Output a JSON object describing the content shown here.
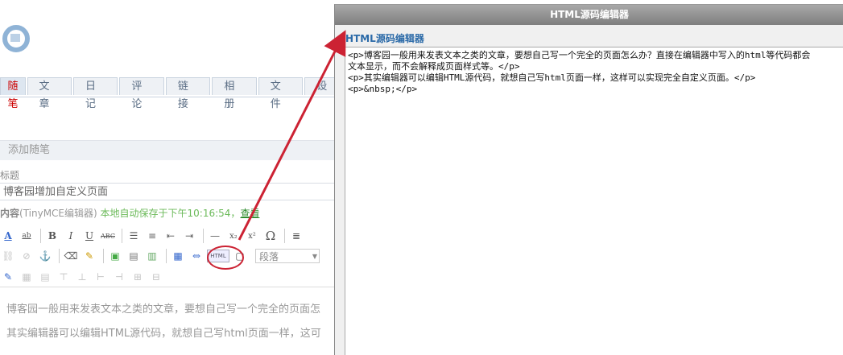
{
  "tabs": [
    {
      "label": "随笔",
      "active": true
    },
    {
      "label": "文章"
    },
    {
      "label": "日记"
    },
    {
      "label": "评论"
    },
    {
      "label": "链接"
    },
    {
      "label": "相册"
    },
    {
      "label": "文件"
    },
    {
      "label": "设置"
    }
  ],
  "add_bar_label": "添加随笔",
  "title_label": "标题",
  "title_value": "博客园增加自定义页面",
  "content_label": {
    "main": "内容",
    "editor": "(TinyMCE编辑器)",
    "autosave": "本地自动保存于下午10:16:54，",
    "link": "查看"
  },
  "toolbar": {
    "html_button": "HTML",
    "format_select": "段落"
  },
  "editor_paragraphs": [
    "博客园一般用来发表文本之类的文章，要想自己写一个完全的页面怎",
    "其实编辑器可以编辑HTML源代码，就想自己写html页面一样，这可"
  ],
  "dialog": {
    "title": "HTML源码编辑器",
    "heading": "HTML源码编辑器",
    "code_lines": [
      "<p>博客园一般用来发表文本之类的文章，要想自己写一个完全的页面怎么办？直接在编辑器中写入的html等代码都会",
      "文本显示，而不会解释成页面样式等。</p>",
      "<p>其实编辑器可以编辑HTML源代码，就想自己写html页面一样，这样可以实现完全自定义页面。</p>",
      "<p>&nbsp;</p>"
    ]
  },
  "colors": {
    "annotation": "#cc2233",
    "dialog_heading": "#2b6aa8",
    "autosave_text": "#6cba5a"
  }
}
